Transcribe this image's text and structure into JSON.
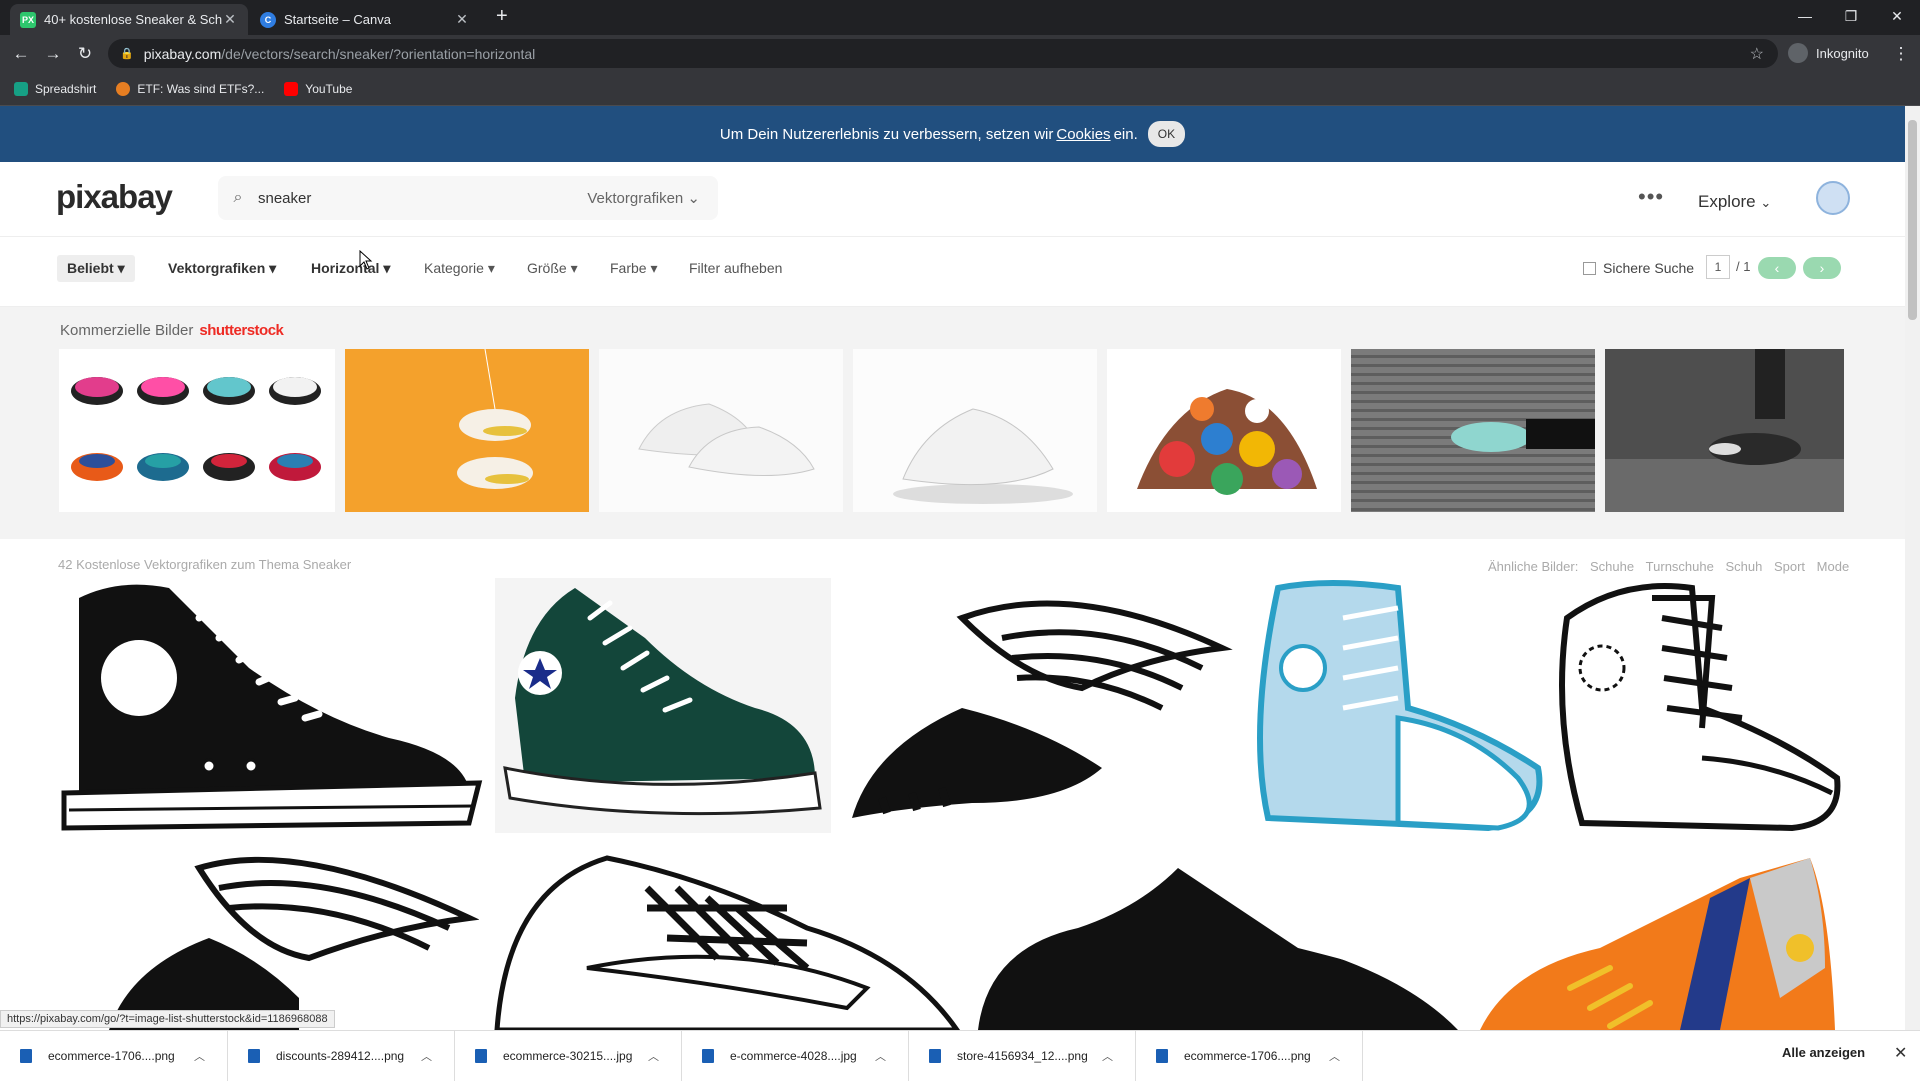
{
  "browser": {
    "tabs": [
      {
        "title": "40+ kostenlose Sneaker & Schuh",
        "favicon_text": "PX"
      },
      {
        "title": "Startseite – Canva",
        "favicon_text": "C"
      }
    ],
    "new_tab": "+",
    "url_host": "pixabay.com",
    "url_path": "/de/vectors/search/sneaker/?orientation=horizontal",
    "profile": "Inkognito",
    "bookmarks": [
      {
        "label": "Spreadshirt",
        "color": "#16a085"
      },
      {
        "label": "ETF: Was sind ETFs?...",
        "color": "#e67e22"
      },
      {
        "label": "YouTube",
        "color": "#ff0000"
      }
    ]
  },
  "cookie": {
    "text_before": "Um Dein Nutzererlebnis zu verbessern, setzen wir",
    "link": "Cookies",
    "text_after": "ein.",
    "ok": "OK"
  },
  "header": {
    "logo": "pixabay",
    "search_value": "sneaker",
    "search_type": "Vektorgrafiken",
    "more": "•••",
    "explore": "Explore"
  },
  "filters": {
    "items": [
      "Beliebt",
      "Vektorgrafiken",
      "Horizontal",
      "Kategorie",
      "Größe",
      "Farbe"
    ],
    "reset": "Filter aufheben",
    "safe_search": "Sichere Suche",
    "page_current": "1",
    "page_total": "/ 1"
  },
  "sponsored": {
    "label": "Kommerzielle Bilder",
    "brand": "shutterstock"
  },
  "results": {
    "info": "42 Kostenlose Vektorgrafiken zum Thema Sneaker",
    "related_label": "Ähnliche Bilder:",
    "related": [
      "Schuhe",
      "Turnschuhe",
      "Schuh",
      "Sport",
      "Mode"
    ]
  },
  "status_url": "https://pixabay.com/go/?t=image-list-shutterstock&id=1186968088",
  "downloads": {
    "items": [
      "ecommerce-1706....png",
      "discounts-289412....png",
      "ecommerce-30215....jpg",
      "e-commerce-4028....jpg",
      "store-4156934_12....png",
      "ecommerce-1706....png"
    ],
    "show_all": "Alle anzeigen"
  }
}
